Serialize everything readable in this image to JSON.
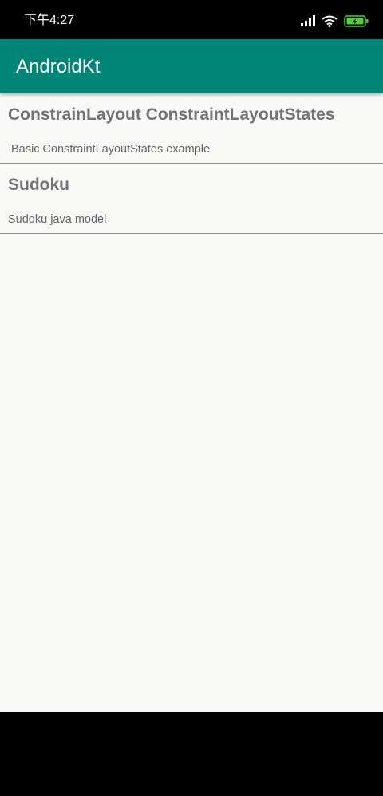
{
  "status_bar": {
    "time": "下午4:27",
    "icons": [
      "signal-icon",
      "wifi-icon",
      "battery-charging-icon"
    ],
    "battery_color": "#4cd137"
  },
  "app_bar": {
    "title": "AndroidKt",
    "color": "#008577"
  },
  "list": {
    "items": [
      {
        "title": "ConstrainLayout ConstraintLayoutStates",
        "description": "Basic ConstraintLayoutStates example"
      },
      {
        "title": "Sudoku",
        "description": "Sudoku java model"
      }
    ]
  }
}
